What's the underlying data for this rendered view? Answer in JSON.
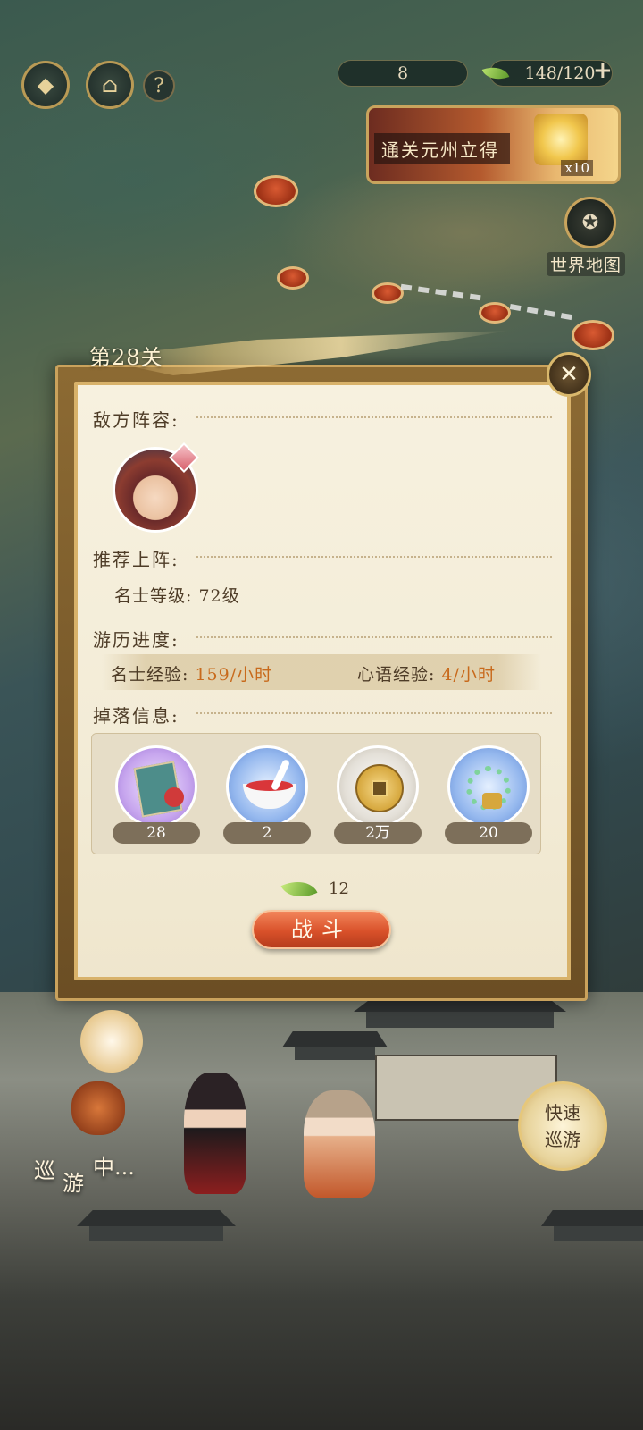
{
  "hud": {
    "stamina_value": "8",
    "leaf_currency": "148/120",
    "help_symbol": "?",
    "plus_symbol": "+"
  },
  "event_banner": {
    "text": "通关元州立得",
    "reward_count": "x10"
  },
  "world_map": {
    "label": "世界地图"
  },
  "panel": {
    "stage_title": "第28关",
    "close_symbol": "✕",
    "sections": {
      "enemy_lineup": "敌方阵容:",
      "recommended": "推荐上阵:",
      "progress": "游历进度:",
      "drops": "掉落信息:"
    },
    "recommended_level_label": "名士等级:",
    "recommended_level_value": "72级",
    "exp_label_1": "名士经验:",
    "exp_value_1": "159/小时",
    "exp_label_2": "心语经验:",
    "exp_value_2": "4/小时",
    "drops": [
      {
        "icon": "book-icon",
        "count": "28"
      },
      {
        "icon": "bowl-icon",
        "count": "2"
      },
      {
        "icon": "coin-icon",
        "count": "2万"
      },
      {
        "icon": "bracelet-icon",
        "count": "20"
      }
    ],
    "cost": "12",
    "fight_label": "战斗"
  },
  "touring": {
    "char1": "巡",
    "char2": "游",
    "char3": "中...",
    "quick_tour_line1": "快速",
    "quick_tour_line2": "巡游"
  },
  "colors": {
    "accent_gold": "#caa25c",
    "fight_button": "#d9512a",
    "exp_value": "#c86a1c",
    "paper": "#f6f0de"
  }
}
